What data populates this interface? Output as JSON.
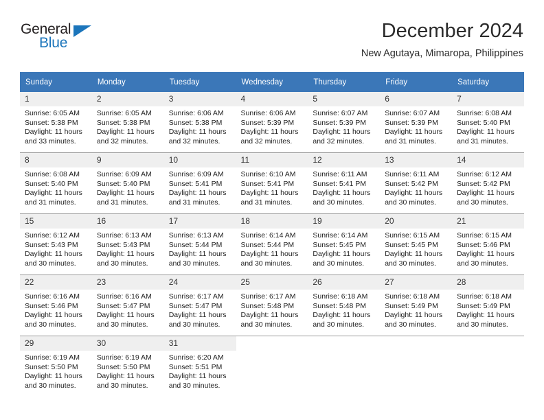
{
  "brand": {
    "name_top": "General",
    "name_bottom": "Blue",
    "triangle_color": "#1b75bb",
    "text_color": "#231f20"
  },
  "header": {
    "title": "December 2024",
    "subtitle": "New Agutaya, Mimaropa, Philippines"
  },
  "theme": {
    "header_bg": "#3b77b8",
    "header_text": "#ffffff",
    "daynum_bg": "#efefef",
    "grid_line": "#9a9a9a",
    "cell_bg": "#ffffff"
  },
  "weekdays": [
    "Sunday",
    "Monday",
    "Tuesday",
    "Wednesday",
    "Thursday",
    "Friday",
    "Saturday"
  ],
  "labels": {
    "sunrise_prefix": "Sunrise:",
    "sunset_prefix": "Sunset:",
    "daylight_prefix": "Daylight:"
  },
  "weeks": [
    [
      {
        "day": "1",
        "sunrise": "Sunrise: 6:05 AM",
        "sunset": "Sunset: 5:38 PM",
        "daylight_line1": "Daylight: 11 hours",
        "daylight_line2": "and 33 minutes."
      },
      {
        "day": "2",
        "sunrise": "Sunrise: 6:05 AM",
        "sunset": "Sunset: 5:38 PM",
        "daylight_line1": "Daylight: 11 hours",
        "daylight_line2": "and 32 minutes."
      },
      {
        "day": "3",
        "sunrise": "Sunrise: 6:06 AM",
        "sunset": "Sunset: 5:38 PM",
        "daylight_line1": "Daylight: 11 hours",
        "daylight_line2": "and 32 minutes."
      },
      {
        "day": "4",
        "sunrise": "Sunrise: 6:06 AM",
        "sunset": "Sunset: 5:39 PM",
        "daylight_line1": "Daylight: 11 hours",
        "daylight_line2": "and 32 minutes."
      },
      {
        "day": "5",
        "sunrise": "Sunrise: 6:07 AM",
        "sunset": "Sunset: 5:39 PM",
        "daylight_line1": "Daylight: 11 hours",
        "daylight_line2": "and 32 minutes."
      },
      {
        "day": "6",
        "sunrise": "Sunrise: 6:07 AM",
        "sunset": "Sunset: 5:39 PM",
        "daylight_line1": "Daylight: 11 hours",
        "daylight_line2": "and 31 minutes."
      },
      {
        "day": "7",
        "sunrise": "Sunrise: 6:08 AM",
        "sunset": "Sunset: 5:40 PM",
        "daylight_line1": "Daylight: 11 hours",
        "daylight_line2": "and 31 minutes."
      }
    ],
    [
      {
        "day": "8",
        "sunrise": "Sunrise: 6:08 AM",
        "sunset": "Sunset: 5:40 PM",
        "daylight_line1": "Daylight: 11 hours",
        "daylight_line2": "and 31 minutes."
      },
      {
        "day": "9",
        "sunrise": "Sunrise: 6:09 AM",
        "sunset": "Sunset: 5:40 PM",
        "daylight_line1": "Daylight: 11 hours",
        "daylight_line2": "and 31 minutes."
      },
      {
        "day": "10",
        "sunrise": "Sunrise: 6:09 AM",
        "sunset": "Sunset: 5:41 PM",
        "daylight_line1": "Daylight: 11 hours",
        "daylight_line2": "and 31 minutes."
      },
      {
        "day": "11",
        "sunrise": "Sunrise: 6:10 AM",
        "sunset": "Sunset: 5:41 PM",
        "daylight_line1": "Daylight: 11 hours",
        "daylight_line2": "and 31 minutes."
      },
      {
        "day": "12",
        "sunrise": "Sunrise: 6:11 AM",
        "sunset": "Sunset: 5:41 PM",
        "daylight_line1": "Daylight: 11 hours",
        "daylight_line2": "and 30 minutes."
      },
      {
        "day": "13",
        "sunrise": "Sunrise: 6:11 AM",
        "sunset": "Sunset: 5:42 PM",
        "daylight_line1": "Daylight: 11 hours",
        "daylight_line2": "and 30 minutes."
      },
      {
        "day": "14",
        "sunrise": "Sunrise: 6:12 AM",
        "sunset": "Sunset: 5:42 PM",
        "daylight_line1": "Daylight: 11 hours",
        "daylight_line2": "and 30 minutes."
      }
    ],
    [
      {
        "day": "15",
        "sunrise": "Sunrise: 6:12 AM",
        "sunset": "Sunset: 5:43 PM",
        "daylight_line1": "Daylight: 11 hours",
        "daylight_line2": "and 30 minutes."
      },
      {
        "day": "16",
        "sunrise": "Sunrise: 6:13 AM",
        "sunset": "Sunset: 5:43 PM",
        "daylight_line1": "Daylight: 11 hours",
        "daylight_line2": "and 30 minutes."
      },
      {
        "day": "17",
        "sunrise": "Sunrise: 6:13 AM",
        "sunset": "Sunset: 5:44 PM",
        "daylight_line1": "Daylight: 11 hours",
        "daylight_line2": "and 30 minutes."
      },
      {
        "day": "18",
        "sunrise": "Sunrise: 6:14 AM",
        "sunset": "Sunset: 5:44 PM",
        "daylight_line1": "Daylight: 11 hours",
        "daylight_line2": "and 30 minutes."
      },
      {
        "day": "19",
        "sunrise": "Sunrise: 6:14 AM",
        "sunset": "Sunset: 5:45 PM",
        "daylight_line1": "Daylight: 11 hours",
        "daylight_line2": "and 30 minutes."
      },
      {
        "day": "20",
        "sunrise": "Sunrise: 6:15 AM",
        "sunset": "Sunset: 5:45 PM",
        "daylight_line1": "Daylight: 11 hours",
        "daylight_line2": "and 30 minutes."
      },
      {
        "day": "21",
        "sunrise": "Sunrise: 6:15 AM",
        "sunset": "Sunset: 5:46 PM",
        "daylight_line1": "Daylight: 11 hours",
        "daylight_line2": "and 30 minutes."
      }
    ],
    [
      {
        "day": "22",
        "sunrise": "Sunrise: 6:16 AM",
        "sunset": "Sunset: 5:46 PM",
        "daylight_line1": "Daylight: 11 hours",
        "daylight_line2": "and 30 minutes."
      },
      {
        "day": "23",
        "sunrise": "Sunrise: 6:16 AM",
        "sunset": "Sunset: 5:47 PM",
        "daylight_line1": "Daylight: 11 hours",
        "daylight_line2": "and 30 minutes."
      },
      {
        "day": "24",
        "sunrise": "Sunrise: 6:17 AM",
        "sunset": "Sunset: 5:47 PM",
        "daylight_line1": "Daylight: 11 hours",
        "daylight_line2": "and 30 minutes."
      },
      {
        "day": "25",
        "sunrise": "Sunrise: 6:17 AM",
        "sunset": "Sunset: 5:48 PM",
        "daylight_line1": "Daylight: 11 hours",
        "daylight_line2": "and 30 minutes."
      },
      {
        "day": "26",
        "sunrise": "Sunrise: 6:18 AM",
        "sunset": "Sunset: 5:48 PM",
        "daylight_line1": "Daylight: 11 hours",
        "daylight_line2": "and 30 minutes."
      },
      {
        "day": "27",
        "sunrise": "Sunrise: 6:18 AM",
        "sunset": "Sunset: 5:49 PM",
        "daylight_line1": "Daylight: 11 hours",
        "daylight_line2": "and 30 minutes."
      },
      {
        "day": "28",
        "sunrise": "Sunrise: 6:18 AM",
        "sunset": "Sunset: 5:49 PM",
        "daylight_line1": "Daylight: 11 hours",
        "daylight_line2": "and 30 minutes."
      }
    ],
    [
      {
        "day": "29",
        "sunrise": "Sunrise: 6:19 AM",
        "sunset": "Sunset: 5:50 PM",
        "daylight_line1": "Daylight: 11 hours",
        "daylight_line2": "and 30 minutes."
      },
      {
        "day": "30",
        "sunrise": "Sunrise: 6:19 AM",
        "sunset": "Sunset: 5:50 PM",
        "daylight_line1": "Daylight: 11 hours",
        "daylight_line2": "and 30 minutes."
      },
      {
        "day": "31",
        "sunrise": "Sunrise: 6:20 AM",
        "sunset": "Sunset: 5:51 PM",
        "daylight_line1": "Daylight: 11 hours",
        "daylight_line2": "and 30 minutes."
      },
      {
        "day": "",
        "sunrise": "",
        "sunset": "",
        "daylight_line1": "",
        "daylight_line2": ""
      },
      {
        "day": "",
        "sunrise": "",
        "sunset": "",
        "daylight_line1": "",
        "daylight_line2": ""
      },
      {
        "day": "",
        "sunrise": "",
        "sunset": "",
        "daylight_line1": "",
        "daylight_line2": ""
      },
      {
        "day": "",
        "sunrise": "",
        "sunset": "",
        "daylight_line1": "",
        "daylight_line2": ""
      }
    ]
  ]
}
